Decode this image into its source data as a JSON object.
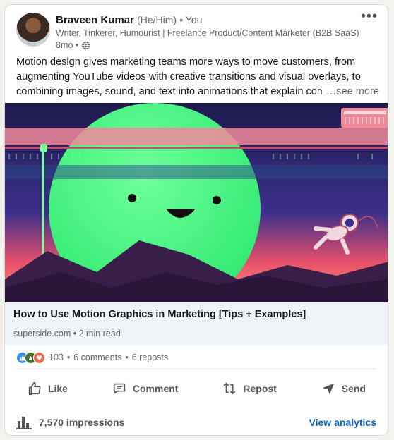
{
  "post": {
    "author": {
      "name": "Braveen Kumar",
      "pronouns": "(He/Him)",
      "degree": "• You",
      "headline": "Writer, Tinkerer, Humourist | Freelance Product/Content Marketer (B2B SaaS)",
      "time": "8mo •"
    },
    "more_label": "•••",
    "body": "Motion design gives marketing teams more ways to move customers, from augmenting YouTube videos with creative transitions and visual overlays, to combining images, sound, and text into animations that explain complex ideas.",
    "see_more": "…see more",
    "link": {
      "title": "How to Use Motion Graphics in Marketing [Tips + Examples]",
      "source": "superside.com • 2 min read"
    },
    "social": {
      "reaction_count": "103",
      "comments": "6 comments",
      "reposts": "6 reposts",
      "sep": "•"
    },
    "actions": {
      "like": "Like",
      "comment": "Comment",
      "repost": "Repost",
      "send": "Send"
    },
    "footer": {
      "impressions": "7,570 impressions",
      "analytics": "View analytics"
    }
  }
}
